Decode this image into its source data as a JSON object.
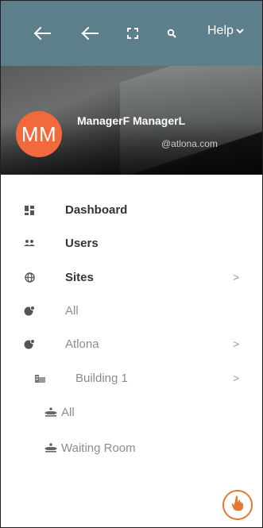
{
  "header": {
    "help_label": "Help"
  },
  "profile": {
    "initials": "MM",
    "name": "ManagerF ManagerL",
    "email": "@atlona.com"
  },
  "menu": [
    {
      "label": "Dashboard",
      "icon": "dashboard-icon"
    },
    {
      "label": "Users",
      "icon": "users-icon"
    },
    {
      "label": "Sites",
      "icon": "globe-icon",
      "chevron": ">"
    },
    {
      "label": "All",
      "icon": "globe-marker-icon"
    },
    {
      "label": "Atlona",
      "icon": "globe-marker-icon",
      "chevron": ">"
    },
    {
      "label": "Building 1",
      "icon": "building-icon",
      "chevron": ">"
    },
    {
      "label": "All",
      "icon": "meeting-room-icon"
    },
    {
      "label": "Waiting Room",
      "icon": "meeting-room-icon"
    }
  ],
  "colors": {
    "header_bg": "#5d7f8b",
    "avatar_bg": "#f26a3c",
    "fab_accent": "#e4792f"
  }
}
